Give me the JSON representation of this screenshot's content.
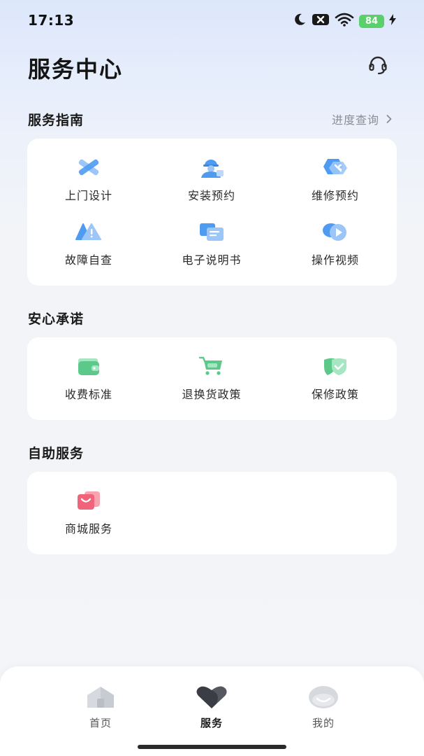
{
  "status_bar": {
    "time": "17:13",
    "battery": "84",
    "icons": [
      "moon-icon",
      "notification-x-icon",
      "wifi-icon",
      "battery-icon",
      "charging-bolt-icon"
    ]
  },
  "header": {
    "title": "服务中心",
    "support_icon": "headset-icon"
  },
  "service_guide": {
    "title": "服务指南",
    "progress_link": "进度查询",
    "items": [
      {
        "label": "上门设计",
        "icon": "pencil-ruler-icon"
      },
      {
        "label": "安装预约",
        "icon": "installer-icon"
      },
      {
        "label": "维修预约",
        "icon": "wrench-gear-icon"
      },
      {
        "label": "故障自查",
        "icon": "warning-triangle-icon"
      },
      {
        "label": "电子说明书",
        "icon": "manual-book-icon"
      },
      {
        "label": "操作视频",
        "icon": "video-play-icon"
      }
    ]
  },
  "assurance": {
    "title": "安心承诺",
    "items": [
      {
        "label": "收费标准",
        "icon": "wallet-icon"
      },
      {
        "label": "退换货政策",
        "icon": "cart-icon"
      },
      {
        "label": "保修政策",
        "icon": "shield-check-icon"
      }
    ]
  },
  "self_service": {
    "title": "自助服务",
    "items": [
      {
        "label": "商城服务",
        "icon": "shopping-bag-icon"
      }
    ]
  },
  "tabbar": {
    "tabs": [
      {
        "label": "首页",
        "icon": "home-icon",
        "active": false
      },
      {
        "label": "服务",
        "icon": "heart-icon",
        "active": true
      },
      {
        "label": "我的",
        "icon": "profile-icon",
        "active": false
      }
    ]
  },
  "colors": {
    "guide_icon_blue": "#4f9bf2",
    "assurance_icon_green": "#5cc98a",
    "self_service_icon_red": "#f0637a",
    "battery_green": "#5ad06a"
  }
}
